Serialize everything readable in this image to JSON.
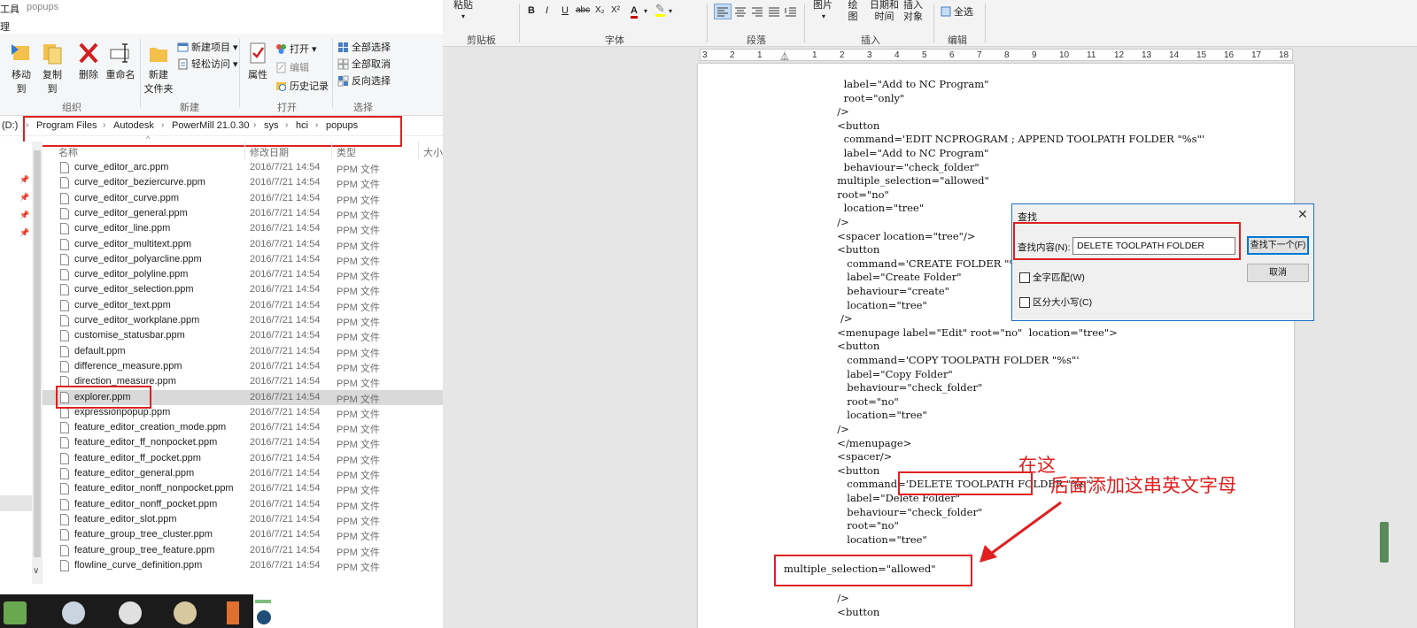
{
  "explorer": {
    "titlebar_left": "工具",
    "titlebar_title": "popups",
    "tab_left": "理",
    "ribbon": {
      "move_to": "移动到",
      "copy_to": "复制到",
      "delete": "删除",
      "rename": "重命名",
      "new_folder_line1": "新建",
      "new_folder_line2": "文件夹",
      "new_item": "新建项目",
      "easy_access": "轻松访问",
      "properties": "属性",
      "open": "打开",
      "edit": "编辑",
      "history": "历史记录",
      "select_all": "全部选择",
      "select_none": "全部取消",
      "invert_selection": "反向选择",
      "group_organize": "组织",
      "group_new": "新建",
      "group_open": "打开",
      "group_select": "选择"
    },
    "address": {
      "drive": "(D:)",
      "crumbs": [
        "Program Files",
        "Autodesk",
        "PowerMill 21.0.30",
        "sys",
        "hci",
        "popups"
      ]
    },
    "columns": {
      "name": "名称",
      "date": "修改日期",
      "type": "类型",
      "size": "大小"
    },
    "files": [
      {
        "name": "curve_editor_arc.ppm",
        "date": "2016/7/21 14:54",
        "type": "PPM 文件"
      },
      {
        "name": "curve_editor_beziercurve.ppm",
        "date": "2016/7/21 14:54",
        "type": "PPM 文件"
      },
      {
        "name": "curve_editor_curve.ppm",
        "date": "2016/7/21 14:54",
        "type": "PPM 文件"
      },
      {
        "name": "curve_editor_general.ppm",
        "date": "2016/7/21 14:54",
        "type": "PPM 文件"
      },
      {
        "name": "curve_editor_line.ppm",
        "date": "2016/7/21 14:54",
        "type": "PPM 文件"
      },
      {
        "name": "curve_editor_multitext.ppm",
        "date": "2016/7/21 14:54",
        "type": "PPM 文件"
      },
      {
        "name": "curve_editor_polyarcline.ppm",
        "date": "2016/7/21 14:54",
        "type": "PPM 文件"
      },
      {
        "name": "curve_editor_polyline.ppm",
        "date": "2016/7/21 14:54",
        "type": "PPM 文件"
      },
      {
        "name": "curve_editor_selection.ppm",
        "date": "2016/7/21 14:54",
        "type": "PPM 文件"
      },
      {
        "name": "curve_editor_text.ppm",
        "date": "2016/7/21 14:54",
        "type": "PPM 文件"
      },
      {
        "name": "curve_editor_workplane.ppm",
        "date": "2016/7/21 14:54",
        "type": "PPM 文件"
      },
      {
        "name": "customise_statusbar.ppm",
        "date": "2016/7/21 14:54",
        "type": "PPM 文件"
      },
      {
        "name": "default.ppm",
        "date": "2016/7/21 14:54",
        "type": "PPM 文件"
      },
      {
        "name": "difference_measure.ppm",
        "date": "2016/7/21 14:54",
        "type": "PPM 文件"
      },
      {
        "name": "direction_measure.ppm",
        "date": "2016/7/21 14:54",
        "type": "PPM 文件"
      },
      {
        "name": "explorer.ppm",
        "date": "2016/7/21 14:54",
        "type": "PPM 文件",
        "selected": true
      },
      {
        "name": "expressionpopup.ppm",
        "date": "2016/7/21 14:54",
        "type": "PPM 文件"
      },
      {
        "name": "feature_editor_creation_mode.ppm",
        "date": "2016/7/21 14:54",
        "type": "PPM 文件"
      },
      {
        "name": "feature_editor_ff_nonpocket.ppm",
        "date": "2016/7/21 14:54",
        "type": "PPM 文件"
      },
      {
        "name": "feature_editor_ff_pocket.ppm",
        "date": "2016/7/21 14:54",
        "type": "PPM 文件"
      },
      {
        "name": "feature_editor_general.ppm",
        "date": "2016/7/21 14:54",
        "type": "PPM 文件"
      },
      {
        "name": "feature_editor_nonff_nonpocket.ppm",
        "date": "2016/7/21 14:54",
        "type": "PPM 文件"
      },
      {
        "name": "feature_editor_nonff_pocket.ppm",
        "date": "2016/7/21 14:54",
        "type": "PPM 文件"
      },
      {
        "name": "feature_editor_slot.ppm",
        "date": "2016/7/21 14:54",
        "type": "PPM 文件"
      },
      {
        "name": "feature_group_tree_cluster.ppm",
        "date": "2016/7/21 14:54",
        "type": "PPM 文件"
      },
      {
        "name": "feature_group_tree_feature.ppm",
        "date": "2016/7/21 14:54",
        "type": "PPM 文件"
      },
      {
        "name": "flowline_curve_definition.ppm",
        "date": "2016/7/21 14:54",
        "type": "PPM 文件"
      }
    ]
  },
  "word": {
    "ribbon": {
      "paste": "粘贴",
      "clipboard": "剪贴板",
      "font": "字体",
      "paragraph": "段落",
      "picture": "图片",
      "drawing": "绘图",
      "datetime_line1": "日期和",
      "datetime_line2": "时间",
      "insert_object_line1": "插入",
      "insert_object_line2": "对象",
      "insert": "插入",
      "select_all": "全选",
      "editing": "编辑",
      "fmt_bold": "B",
      "fmt_italic": "I",
      "fmt_underline": "U",
      "fmt_strike": "abc",
      "fmt_sub": "X₂",
      "fmt_sup": "X²",
      "fmt_color": "A"
    },
    "ruler_ticks": [
      "3",
      "2",
      "1",
      "",
      "1",
      "2",
      "3",
      "4",
      "5",
      "6",
      "7",
      "8",
      "9",
      "10",
      "11",
      "12",
      "13",
      "14",
      "15",
      "16",
      "17",
      "18"
    ],
    "code_lines": [
      "    label=\"Add to NC Program\"",
      "    root=\"only\"",
      "  />",
      "  <button",
      "    command='EDIT NCPROGRAM ; APPEND TOOLPATH FOLDER \"%s\"'",
      "    label=\"Add to NC Program\"",
      "    behaviour=\"check_folder\"",
      "  multiple_selection=\"allowed\"",
      "  root=\"no\"",
      "    location=\"tree\"",
      "  />",
      "  <spacer location=\"tree\"/>",
      "  <button",
      "     command='CREATE FOLDER \"%s\"'",
      "     label=\"Create Folder\"",
      "     behaviour=\"create\"",
      "     location=\"tree\"",
      "   />",
      "  <menupage label=\"Edit\" root=\"no\"  location=\"tree\">",
      "  <button",
      "     command='COPY TOOLPATH FOLDER \"%s\"'",
      "     label=\"Copy Folder\"",
      "     behaviour=\"check_folder\"",
      "     root=\"no\"",
      "     location=\"tree\"",
      "  />",
      "  </menupage>",
      "  <spacer/>",
      "  <button",
      "     command='DELETE TOOLPATH FOLDER \"%s\"'",
      "     label=\"Delete Folder\"",
      "     behaviour=\"check_folder\"",
      "     root=\"no\"",
      "     location=\"tree\""
    ],
    "inserted_line": "multiple_selection=\"allowed\"",
    "tail_lines": [
      "  />",
      "  <button"
    ],
    "find_dialog": {
      "title": "查找",
      "find_label": "查找内容(N):",
      "find_value": "DELETE TOOLPATH FOLDER",
      "find_next": "查找下一个(F)",
      "cancel": "取消",
      "match_whole": "全字匹配(W)",
      "match_case": "区分大小写(C)"
    },
    "annotation_line1": "在这",
    "annotation_line2": "后面添加这串英文字母",
    "annotation_color": "#e02020"
  }
}
